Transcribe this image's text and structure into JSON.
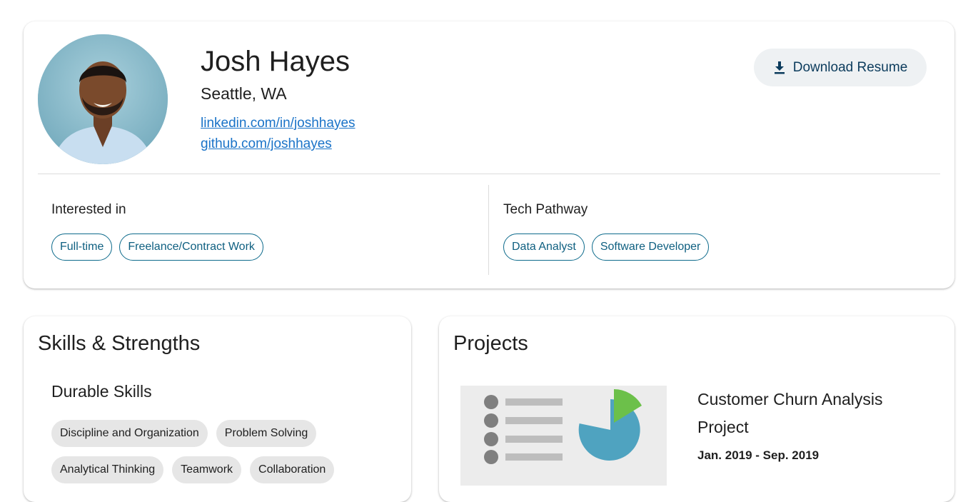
{
  "profile": {
    "name": "Josh Hayes",
    "location": "Seattle, WA",
    "links": {
      "linkedin": "linkedin.com/in/joshhayes",
      "github": "github.com/joshhayes"
    },
    "download_label": "Download Resume",
    "interested": {
      "label": "Interested in",
      "chips": [
        "Full-time",
        "Freelance/Contract Work"
      ]
    },
    "pathway": {
      "label": "Tech Pathway",
      "chips": [
        "Data Analyst",
        "Software Developer"
      ]
    }
  },
  "skills": {
    "title": "Skills & Strengths",
    "durable_heading": "Durable Skills",
    "durable": [
      "Discipline and Organization",
      "Problem Solving",
      "Analytical Thinking",
      "Teamwork",
      "Collaboration"
    ]
  },
  "projects": {
    "title": "Projects",
    "items": [
      {
        "title": "Customer Churn Analysis Project",
        "dates": "Jan. 2019 - Sep. 2019"
      }
    ]
  },
  "colors": {
    "accent": "#0e6b8c",
    "link": "#1a73c8",
    "chart_blue": "#4fa3c0",
    "chart_green": "#6cc04a"
  }
}
